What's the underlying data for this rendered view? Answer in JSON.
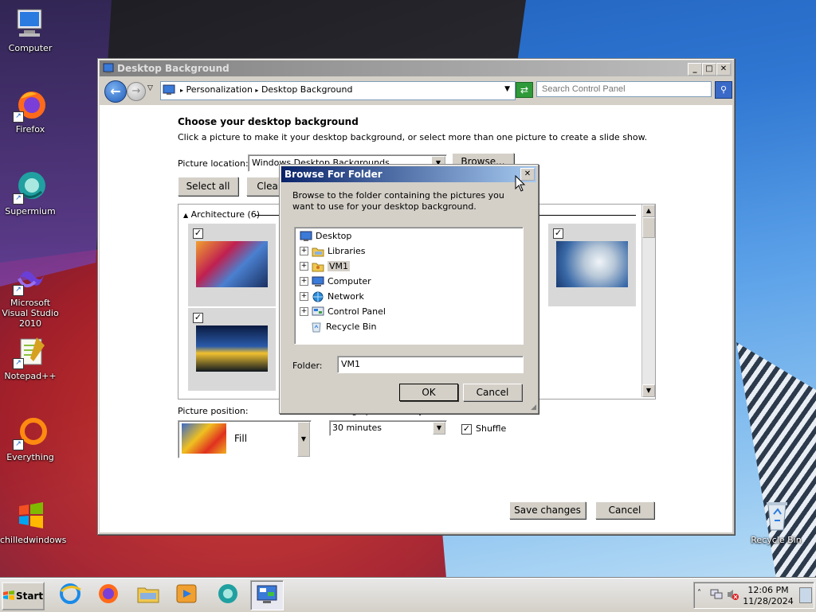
{
  "desktop": {
    "icons": [
      {
        "label": "Computer",
        "icon": "computer-icon"
      },
      {
        "label": "Firefox",
        "icon": "firefox-icon"
      },
      {
        "label": "Supermium",
        "icon": "supermium-icon"
      },
      {
        "label": "Microsoft Visual Studio 2010",
        "icon": "visual-studio-icon"
      },
      {
        "label": "Notepad++",
        "icon": "notepadpp-icon"
      },
      {
        "label": "Everything",
        "icon": "everything-icon"
      },
      {
        "label": "chilledwindows",
        "icon": "windows-logo-icon"
      },
      {
        "label": "Recycle Bin",
        "icon": "recycle-bin-icon"
      }
    ]
  },
  "main_window": {
    "title": "Desktop Background",
    "breadcrumb": [
      "Personalization",
      "Desktop Background"
    ],
    "search_placeholder": "Search Control Panel",
    "heading": "Choose your desktop background",
    "description": "Click a picture to make it your desktop background, or select more than one picture to create a slide show.",
    "picture_location_label": "Picture location:",
    "picture_location_value": "Windows Desktop Backgrounds",
    "browse_label": "Browse...",
    "select_all_label": "Select all",
    "clear_all_label": "Clear all",
    "group_label": "Architecture (6)",
    "picture_position_label": "Picture position:",
    "picture_position_value": "Fill",
    "change_picture_label": "Change picture every:",
    "interval_value": "30 minutes",
    "shuffle_label": "Shuffle",
    "shuffle_checked": true,
    "save_label": "Save changes",
    "cancel_label": "Cancel"
  },
  "dialog": {
    "title": "Browse For Folder",
    "description": "Browse to the folder containing the pictures you want to use for your desktop background.",
    "tree": [
      {
        "label": "Desktop",
        "icon": "desktop-folder-icon",
        "expander": false,
        "level": 0
      },
      {
        "label": "Libraries",
        "icon": "libraries-icon",
        "expander": true,
        "level": 1
      },
      {
        "label": "VM1",
        "icon": "user-folder-icon",
        "expander": true,
        "level": 1,
        "selected": true
      },
      {
        "label": "Computer",
        "icon": "computer-icon",
        "expander": true,
        "level": 1
      },
      {
        "label": "Network",
        "icon": "network-icon",
        "expander": true,
        "level": 1
      },
      {
        "label": "Control Panel",
        "icon": "control-panel-icon",
        "expander": true,
        "level": 1
      },
      {
        "label": "Recycle Bin",
        "icon": "recycle-bin-icon",
        "expander": false,
        "level": 1
      }
    ],
    "folder_label": "Folder:",
    "folder_value": "VM1",
    "ok_label": "OK",
    "cancel_label": "Cancel"
  },
  "taskbar": {
    "start_label": "Start",
    "apps": [
      "internet-explorer-icon",
      "firefox-icon",
      "explorer-icon",
      "media-player-icon",
      "supermium-icon",
      "control-panel-icon"
    ],
    "time": "12:06 PM",
    "date": "11/28/2024"
  },
  "colors": {
    "dialog_title": "#0a246a",
    "inactive_title": "#808080",
    "selection": "#d4d0c8"
  }
}
